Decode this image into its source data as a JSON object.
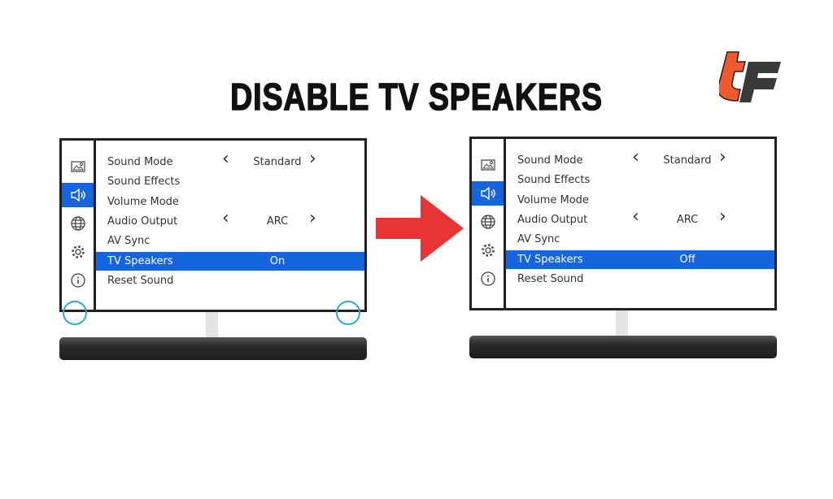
{
  "title": "DISABLE TV SPEAKERS",
  "logo": {
    "text": "tc",
    "colors": [
      "#f05a2a",
      "#3a3a3a"
    ]
  },
  "accent": "#1565e0",
  "arrow_color": "#e83434",
  "sidebar_icons": [
    "picture-icon",
    "speaker-icon",
    "globe-icon",
    "gear-icon",
    "info-icon"
  ],
  "tvs": [
    {
      "menu": [
        {
          "label": "Sound Mode",
          "value": "Standard",
          "arrows": true
        },
        {
          "label": "Sound Effects"
        },
        {
          "label": "Volume Mode"
        },
        {
          "label": "Audio Output",
          "value": "ARC",
          "arrows": true
        },
        {
          "label": "AV Sync"
        },
        {
          "label": "TV Speakers",
          "value": "On",
          "selected": true
        },
        {
          "label": "Reset Sound"
        }
      ],
      "circles": true
    },
    {
      "menu": [
        {
          "label": "Sound Mode",
          "value": "Standard",
          "arrows": true
        },
        {
          "label": "Sound Effects"
        },
        {
          "label": "Volume Mode"
        },
        {
          "label": "Audio Output",
          "value": "ARC",
          "arrows": true
        },
        {
          "label": "AV Sync"
        },
        {
          "label": "TV Speakers",
          "value": "Off",
          "selected": true
        },
        {
          "label": "Reset Sound"
        }
      ],
      "circles": false
    }
  ]
}
